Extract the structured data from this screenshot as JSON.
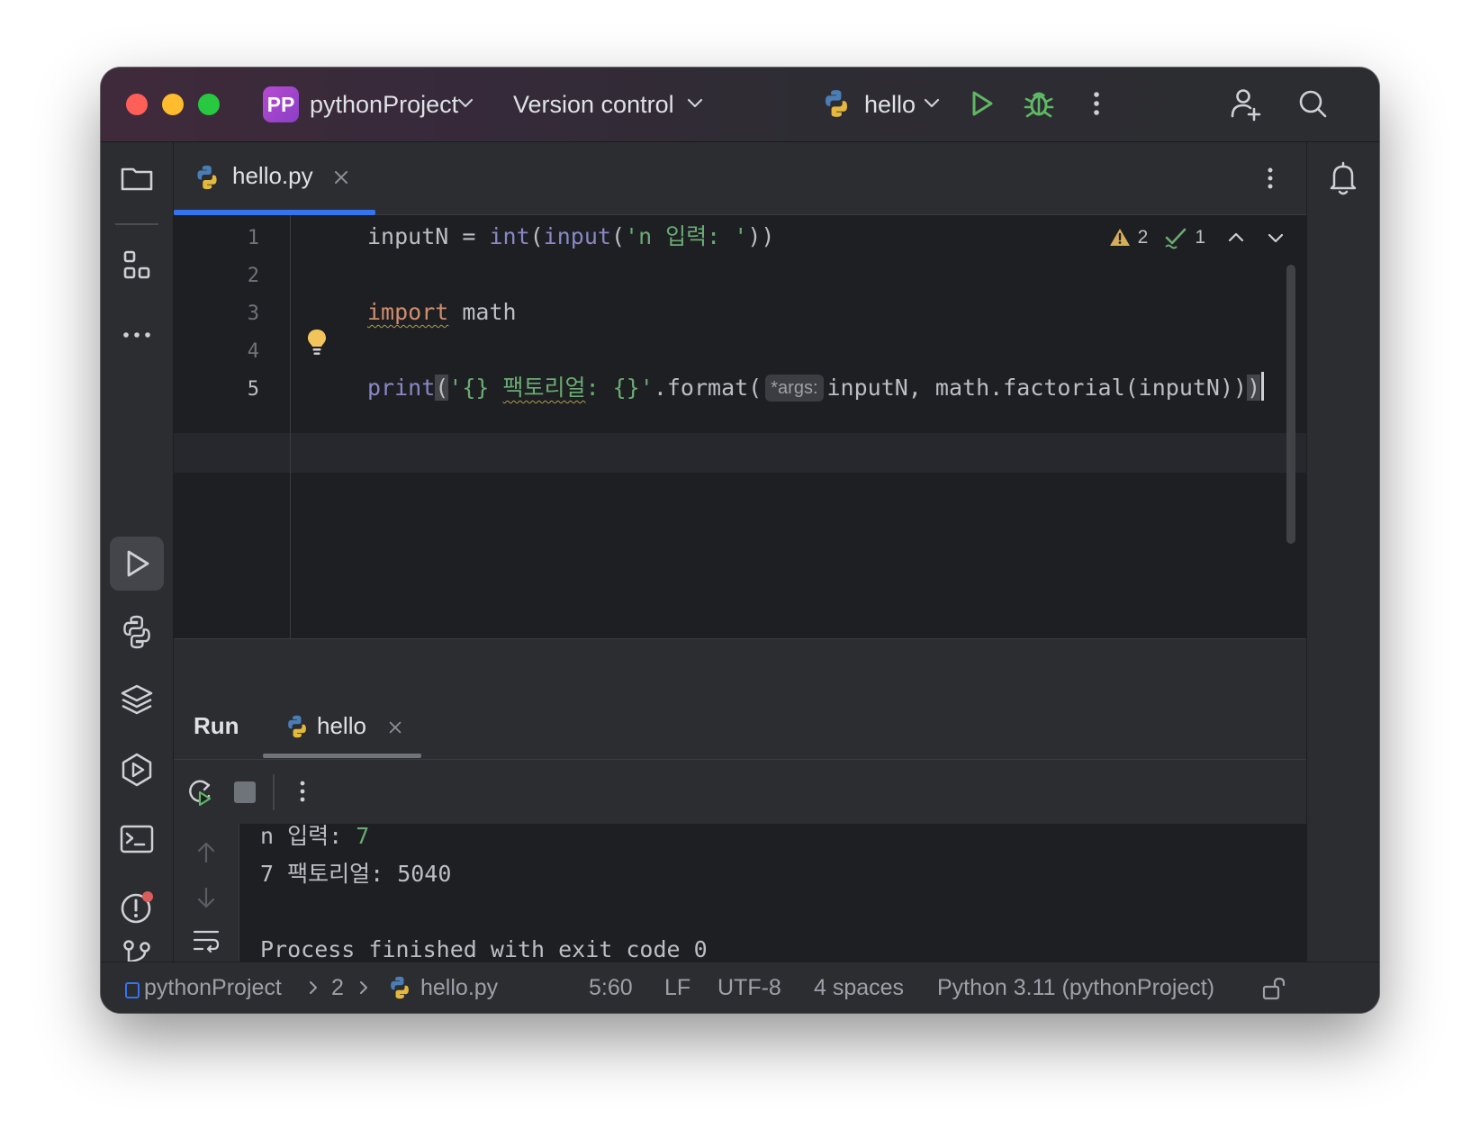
{
  "titlebar": {
    "project_badge": "PP",
    "project_name": "pythonProject",
    "vcs_label": "Version control",
    "run_config": "hello"
  },
  "editor": {
    "tab": {
      "filename": "hello.py"
    },
    "line_numbers": [
      "1",
      "2",
      "3",
      "4",
      "5"
    ],
    "lines": {
      "l1_var": "inputN = ",
      "l1_int": "int",
      "l1_paren1": "(",
      "l1_input": "input",
      "l1_paren2": "(",
      "l1_str": "'n 입력: '",
      "l1_close": "))",
      "l3_kw": "import",
      "l3_rest": " math",
      "l5_print": "print",
      "l5_paren": "(",
      "l5_str_a": "'{} ",
      "l5_str_b": "팩토리얼",
      "l5_str_c": ": {}'",
      "l5_format": ".format(",
      "l5_hint": "*args:",
      "l5_args": "inputN, math.factorial(inputN))",
      "l5_last": ")"
    },
    "inspections": {
      "warnings": "2",
      "weak_warnings": "1"
    },
    "current_line": 5
  },
  "run_panel": {
    "title": "Run",
    "tab_label": "hello",
    "console": {
      "line1_prompt": "n 입력: ",
      "line1_input": "7",
      "line2": "7 팩토리얼: 5040",
      "line3": "Process finished with exit code 0"
    }
  },
  "statusbar": {
    "crumb_project": "pythonProject",
    "crumb_folder": "2",
    "crumb_file": "hello.py",
    "position": "5:60",
    "line_sep": "LF",
    "encoding": "UTF-8",
    "indent": "4 spaces",
    "interpreter": "Python 3.11 (pythonProject)"
  },
  "colors": {
    "accent": "#3574f0",
    "run_green": "#5fb865",
    "string_green": "#6aab73",
    "keyword_orange": "#cf8e6d",
    "builtin_purple": "#8888c6"
  }
}
